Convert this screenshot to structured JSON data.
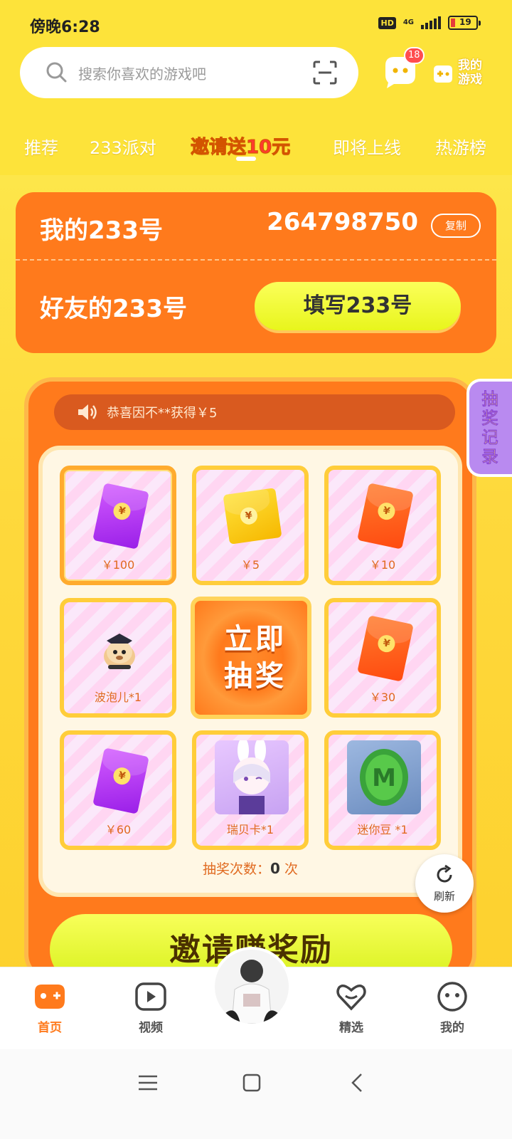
{
  "status_bar": {
    "time": "傍晚6:28",
    "hd": "HD",
    "network": "4G",
    "battery": "19"
  },
  "search": {
    "placeholder": "搜索你喜欢的游戏吧"
  },
  "header": {
    "message_badge": "18",
    "my_games_label": "我的游戏"
  },
  "tabs": [
    {
      "label": "推荐"
    },
    {
      "label": "233派对"
    },
    {
      "label_prefix": "邀请",
      "label_highlight": "送10元",
      "active": true
    },
    {
      "label": "即将上线"
    },
    {
      "label": "热游榜"
    }
  ],
  "invite": {
    "my_id_label": "我的233号",
    "my_id_value": "264798750",
    "copy_label": "复制",
    "friend_id_label": "好友的233号",
    "fill_button": "填写233号"
  },
  "lottery": {
    "ticker": "恭喜因不**获得￥5",
    "record_tab": "抽奖记录",
    "center_button": "立即抽奖",
    "prizes": [
      {
        "label": "￥100",
        "icon": "red-envelope-purple"
      },
      {
        "label": "￥5",
        "icon": "red-envelope-yellow"
      },
      {
        "label": "￥10",
        "icon": "red-envelope-orange"
      },
      {
        "label": "波泡儿*1",
        "icon": "pet-character"
      },
      {
        "label": "￥30",
        "icon": "red-envelope-orange"
      },
      {
        "label": "￥60",
        "icon": "red-envelope-purple"
      },
      {
        "label": "瑞贝卡*1",
        "icon": "character-card"
      },
      {
        "label": "迷你豆 *1",
        "icon": "mini-bean"
      }
    ],
    "draw_count_label": "抽奖次数：",
    "draw_count_value": "0",
    "draw_count_unit": "次",
    "refresh_label": "刷新",
    "invite_button": "邀请赚奖励"
  },
  "bottom_nav": [
    {
      "label": "首页",
      "icon": "gamepad-icon",
      "active": true
    },
    {
      "label": "视频",
      "icon": "video-icon"
    },
    {
      "label": "精选",
      "icon": "heart-icon"
    },
    {
      "label": "我的",
      "icon": "face-icon"
    }
  ],
  "colors": {
    "accent": "#ff7a1c",
    "background": "#fde33a",
    "highlight": "#ff3b2f"
  }
}
